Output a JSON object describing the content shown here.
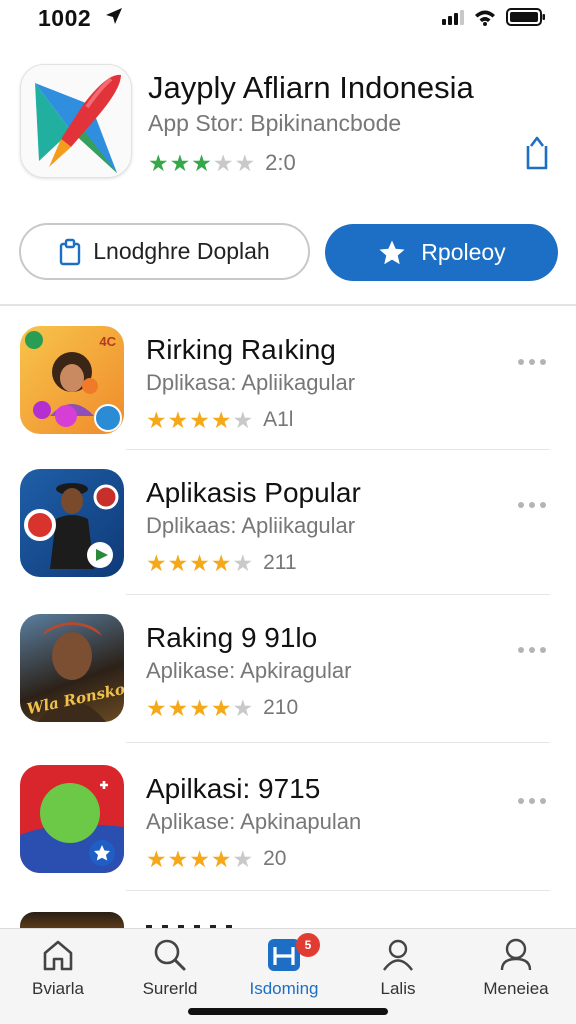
{
  "status_bar": {
    "time": "1002",
    "icons": [
      "location-arrow-icon",
      "signal-icon",
      "wifi-icon",
      "battery-icon"
    ]
  },
  "app": {
    "title": "Jayply Afliarn Indonesia",
    "subtitle": "App Stor: Bpikinancbode",
    "rating_value": "2:0",
    "stars_filled": 3,
    "stars_total": 5,
    "star_color": "#36a84a"
  },
  "actions": {
    "secondary_label": "Lnodghre Doplah",
    "primary_label": "Rpoleoy",
    "primary_color": "#1d6fc5"
  },
  "list": [
    {
      "title": "Rirking Raıking",
      "subtitle": "Dplikasa: Apliikagular",
      "rating": "A1l",
      "stars_filled": 4
    },
    {
      "title": "Aplikasis Popular",
      "subtitle": "Dplikaas: Apliikagular",
      "rating": "211",
      "stars_filled": 4
    },
    {
      "title": "Raking 9 91lo",
      "subtitle": "Aplikase: Apkiragular",
      "rating": "210",
      "stars_filled": 4
    },
    {
      "title": "Apilkasi: 9715",
      "subtitle": "Aplikase: Apkinapulan",
      "rating": "20",
      "stars_filled": 4
    }
  ],
  "list_icon_text": {
    "item1_badge": "4C",
    "item3_caption": "Wla Ronsko"
  },
  "tabs": [
    {
      "label": "Bviarla",
      "icon": "home-icon"
    },
    {
      "label": "Surerld",
      "icon": "search-icon"
    },
    {
      "label": "Isdoming",
      "icon": "updates-icon",
      "active": true,
      "badge": "5"
    },
    {
      "label": "Lalis",
      "icon": "person-icon"
    },
    {
      "label": "Meneiea",
      "icon": "profile-icon"
    }
  ],
  "colors": {
    "accent": "#1d6fc5",
    "gold_star": "#f5a818",
    "badge": "#e23b32"
  }
}
